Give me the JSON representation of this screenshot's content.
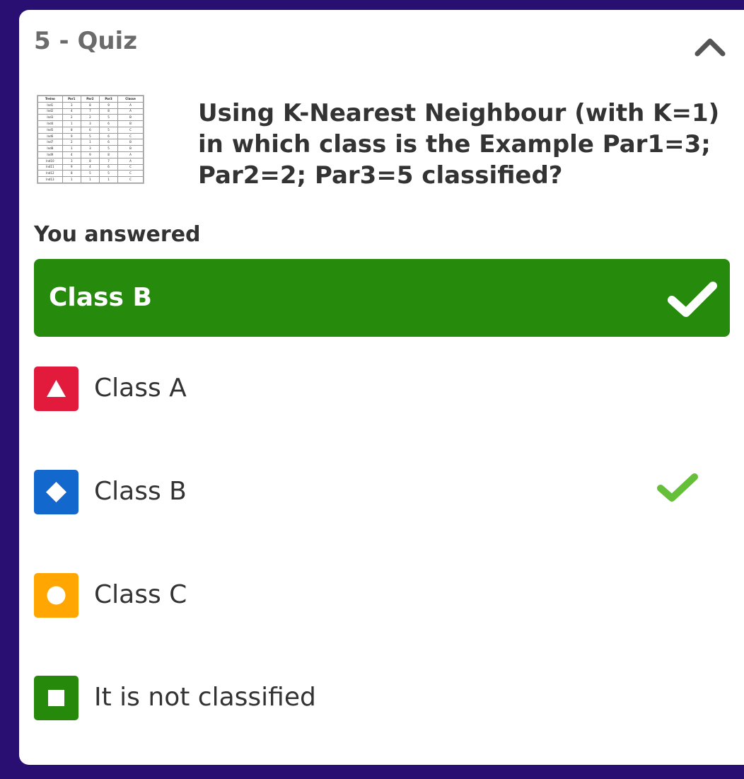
{
  "header": {
    "title": "5 - Quiz",
    "collapse_icon": "chevron-up-icon"
  },
  "question": {
    "text": "Using K-Nearest Neighbour (with K=1) in which class is the Example Par1=3; Par2=2; Par3=5 classified?",
    "image_table": {
      "headers": [
        "Treino",
        "Par1",
        "Par2",
        "Par3",
        "Classe"
      ],
      "rows": [
        [
          "Ind1",
          "3",
          "8",
          "9",
          "A"
        ],
        [
          "Ind2",
          "4",
          "7",
          "8",
          "A"
        ],
        [
          "Ind3",
          "2",
          "2",
          "5",
          "B"
        ],
        [
          "Ind4",
          "1",
          "3",
          "6",
          "B"
        ],
        [
          "Ind5",
          "8",
          "6",
          "5",
          "C"
        ],
        [
          "Ind6",
          "9",
          "5",
          "6",
          "C"
        ],
        [
          "Ind7",
          "2",
          "1",
          "6",
          "B"
        ],
        [
          "Ind8",
          "1",
          "3",
          "5",
          "B"
        ],
        [
          "Ind9",
          "4",
          "9",
          "8",
          "A"
        ],
        [
          "Ind10",
          "3",
          "8",
          "7",
          "A"
        ],
        [
          "Ind11",
          "9",
          "4",
          "6",
          "C"
        ],
        [
          "Ind12",
          "8",
          "5",
          "5",
          "C"
        ],
        [
          "Ind13",
          "1",
          "1",
          "1",
          "C"
        ]
      ]
    }
  },
  "answered": {
    "label": "You answered",
    "answer": "Class B",
    "status_icon": "checkmark-icon",
    "color": "#268a0d"
  },
  "options": [
    {
      "label": "Class A",
      "shape": "triangle-icon",
      "color": "#e21b3c",
      "correct": false
    },
    {
      "label": "Class B",
      "shape": "diamond-icon",
      "color": "#1368ce",
      "correct": true
    },
    {
      "label": "Class C",
      "shape": "circle-icon",
      "color": "#ffa602",
      "correct": false
    },
    {
      "label": "It is not classified",
      "shape": "square-icon",
      "color": "#26890c",
      "correct": false
    }
  ],
  "colors": {
    "background": "#2a0f73",
    "card": "#ffffff",
    "correct_check": "#66bf39"
  }
}
